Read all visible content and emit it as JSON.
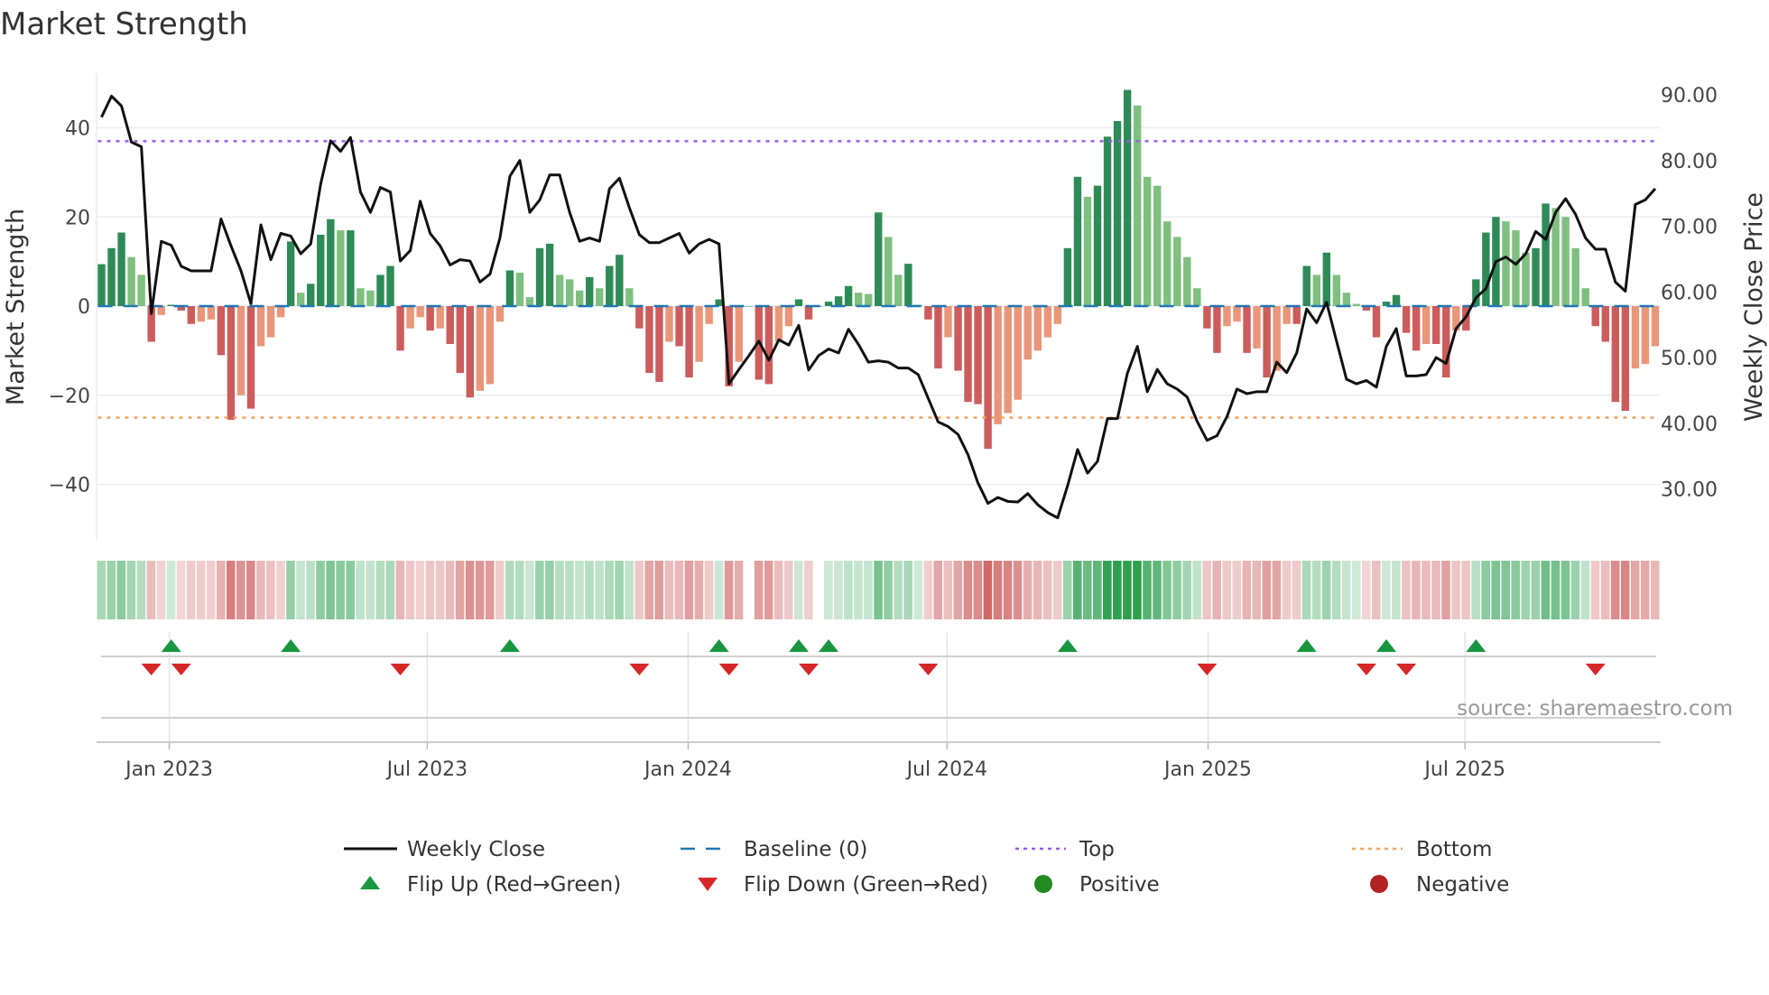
{
  "chart_data": {
    "type": "bar",
    "title": "Market Strength",
    "ylabel": "Market Strength",
    "y2label": "Weekly Close Price",
    "ylim": [
      -52,
      52
    ],
    "y2lim": [
      22.8,
      92.8
    ],
    "yticks": [
      "40",
      "20",
      "0",
      "−20",
      "−40"
    ],
    "ytick_values": [
      40,
      20,
      0,
      -20,
      -40
    ],
    "y2ticks": [
      "90.00",
      "80.00",
      "70.00",
      "60.00",
      "50.00",
      "40.00",
      "30.00"
    ],
    "y2tick_values": [
      90,
      80,
      70,
      60,
      50,
      40,
      30
    ],
    "xticks": [
      "Jan 2023",
      "Jul 2023",
      "Jan 2024",
      "Jul 2024",
      "Jan 2025",
      "Jul 2025"
    ],
    "xtick_week_index": [
      6.8,
      32.7,
      58.9,
      84.9,
      111.1,
      136.9
    ],
    "frequency": "weekly",
    "top_level": 37,
    "bottom_level": -25,
    "baseline": 0,
    "colors": {
      "pos_strong": "#2e8b57",
      "pos_weak": "#7fbf7f",
      "neg_strong": "#cd5c5c",
      "neg_weak": "#e9967a",
      "price": "#111111",
      "baseline": "#1f77b4",
      "top": "#9b5de5",
      "bottom": "#f4a460",
      "flip_up": "#1a9641",
      "flip_down": "#d62728",
      "positive": "#228b22",
      "negative": "#b22222"
    },
    "strength": [
      9.4,
      13,
      16.5,
      11,
      7,
      -8,
      -2,
      0.3,
      -1,
      -4,
      -3.5,
      -3,
      -11,
      -25.5,
      -20,
      -23,
      -9,
      -7,
      -2.5,
      14.5,
      3,
      5,
      16,
      19.5,
      17,
      17,
      4,
      3.5,
      7,
      9,
      -10,
      -5,
      -2.5,
      -5.5,
      -5,
      -8.5,
      -15,
      -20.5,
      -19,
      -17.5,
      -3.5,
      8,
      7.5,
      2,
      13,
      14,
      7,
      6,
      3.5,
      6.5,
      4,
      9,
      11.5,
      4,
      -5,
      -15,
      -17,
      -8,
      -9,
      -16,
      -12.5,
      -4,
      1.5,
      -18,
      -12.5,
      0,
      -16.5,
      -17.5,
      -8,
      -4.5,
      1.5,
      -3,
      0,
      1,
      2.2,
      4.5,
      3,
      2.7,
      21,
      15.5,
      7,
      9.5,
      0.3,
      -3,
      -14,
      -7,
      -14.5,
      -21.5,
      -22,
      -32,
      -26.5,
      -24,
      -21,
      -12,
      -10,
      -7,
      -4,
      13,
      29,
      24.5,
      27,
      38,
      41.5,
      48.5,
      45,
      29,
      27,
      19,
      15.5,
      11,
      4,
      -5,
      -10.5,
      -4.5,
      -3.5,
      -10.5,
      -9.5,
      -16,
      -14.5,
      -4,
      -4,
      9,
      7,
      12,
      7,
      3,
      0.5,
      -1,
      -7,
      1,
      2.5,
      -6,
      -10,
      -8.5,
      -8.5,
      -16,
      -5.5,
      -5.5,
      6,
      16.5,
      20,
      19,
      17,
      12,
      13,
      23,
      22,
      20,
      13,
      4,
      -4.5,
      -8,
      -21.5,
      -23.5,
      -14,
      -13,
      -9
    ],
    "weekly_close": [
      86.6,
      89.8,
      88.3,
      82.8,
      82.1,
      56.7,
      67.7,
      67.1,
      63.9,
      63.2,
      63.2,
      63.2,
      71.1,
      67.0,
      63.2,
      58.2,
      70.2,
      64.9,
      68.9,
      68.5,
      65.8,
      67.3,
      76.4,
      83.0,
      81.4,
      83.5,
      75.2,
      72.1,
      75.9,
      75.2,
      64.7,
      66.3,
      73.8,
      68.9,
      67.0,
      64.1,
      64.9,
      64.7,
      61.5,
      62.7,
      68.2,
      77.6,
      80.0,
      72.1,
      74.0,
      77.8,
      77.8,
      72.1,
      67.7,
      68.2,
      67.7,
      75.7,
      77.3,
      72.8,
      68.7,
      67.5,
      67.5,
      68.2,
      68.9,
      65.9,
      67.3,
      68.0,
      67.3,
      46.0,
      48.2,
      50.3,
      52.5,
      49.6,
      52.7,
      51.9,
      54.9,
      48.1,
      50.3,
      51.3,
      50.7,
      54.3,
      52.0,
      49.3,
      49.5,
      49.3,
      48.4,
      48.4,
      47.4,
      43.8,
      40.2,
      39.5,
      38.3,
      35.2,
      30.9,
      27.8,
      28.7,
      28.1,
      28.0,
      29.3,
      27.6,
      26.4,
      25.6,
      30.5,
      36.0,
      32.4,
      34.2,
      40.7,
      40.7,
      47.6,
      51.7,
      44.8,
      48.2,
      46.0,
      45.2,
      44.0,
      40.3,
      37.4,
      38.1,
      41.0,
      45.2,
      44.5,
      44.8,
      44.8,
      49.3,
      47.7,
      50.7,
      57.4,
      55.3,
      58.4,
      52.5,
      46.7,
      46.0,
      46.5,
      45.5,
      51.7,
      54.4,
      47.2,
      47.2,
      47.4,
      50.0,
      49.1,
      54.4,
      56.2,
      59.1,
      60.5,
      64.6,
      65.3,
      64.2,
      65.8,
      69.2,
      68.0,
      72.1,
      74.2,
      71.8,
      68.2,
      66.5,
      66.5,
      61.5,
      60.1,
      73.3,
      74.0,
      75.7
    ],
    "legend": {
      "placement": "bottom",
      "items": [
        "Weekly Close",
        "Baseline (0)",
        "Top",
        "Bottom",
        "Flip Up (Red→Green)",
        "Flip Down (Green→Red)",
        "Positive",
        "Negative"
      ]
    },
    "source": "source: sharemaestro.com"
  }
}
